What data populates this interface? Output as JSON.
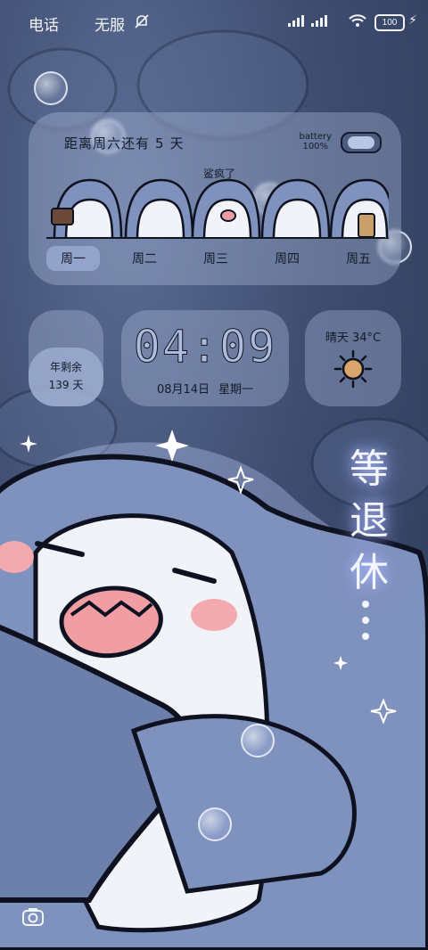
{
  "status": {
    "carrier": "电话",
    "carrier2": "无服",
    "battery": "100"
  },
  "week_widget": {
    "title_prefix": "距离周六还有",
    "days_left": "5",
    "title_suffix": "天",
    "battery_label": "battery",
    "battery_percent": "100%",
    "tag_text": "鲨疯了",
    "days": [
      "周一",
      "周二",
      "周三",
      "周四",
      "周五"
    ],
    "active_day": "周一"
  },
  "year_widget": {
    "line1": "年剩余",
    "line2": "139 天"
  },
  "clock_widget": {
    "time": "04:09",
    "date": "08月14日",
    "weekday": "星期一"
  },
  "weather_widget": {
    "condition": "晴天",
    "temperature": "34°C",
    "icon": "sun-icon"
  },
  "slogan": [
    "等",
    "退",
    "休"
  ],
  "colors": {
    "background": "#3e4d70",
    "shark_blue": "#7f91bd",
    "card_glass": "#bccbe9"
  }
}
